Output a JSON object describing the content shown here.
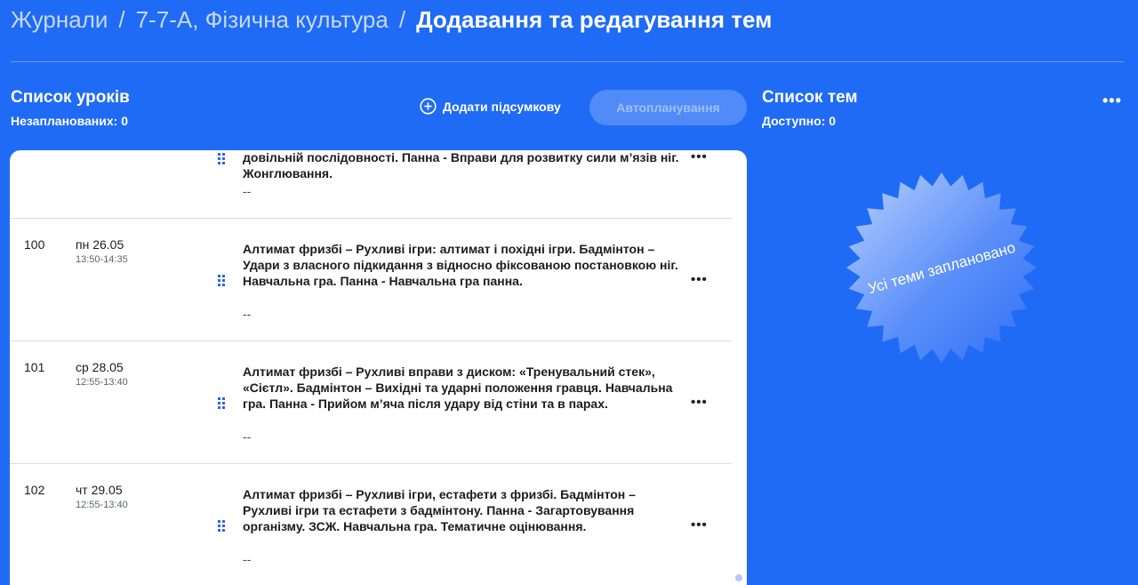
{
  "breadcrumb": {
    "journals": "Журнали",
    "separator": "/",
    "class_subject": "7-7-А, Фізична культура",
    "current": "Додавання та редагування тем"
  },
  "lessons": {
    "title": "Список уроків",
    "unplanned": "Незапланованих: 0",
    "add_summary_label": "Додати підсумкову",
    "add_summary_icon": "plus-circle-icon",
    "autoplan_label": "Автопланування",
    "rows": [
      {
        "number": "",
        "date": "",
        "time": "",
        "topic": "довільній послідовності. Панна - Вправи для розвитку сили м’язів ніг. Жонглювання.",
        "note": "--"
      },
      {
        "number": "100",
        "date": "пн 26.05",
        "time": "13:50-14:35",
        "topic": "Алтимат фризбі – Рухливі ігри: алтимат і похідні ігри. Бадмінтон – Удари з власного підкидання з відносно фіксованою постановкою ніг. Навчальна гра. Панна - Навчальна гра панна.",
        "note": "--"
      },
      {
        "number": "101",
        "date": "ср 28.05",
        "time": "12:55-13:40",
        "topic": "Алтимат фризбі – Рухливі вправи з диском: «Тренувальний стек», «Сієтл». Бадмінтон – Вихідні та ударні положення гравця. Навчальна гра. Панна - Прийом м’яча після удару від стіни та в парах.",
        "note": "--"
      },
      {
        "number": "102",
        "date": "чт 29.05",
        "time": "12:55-13:40",
        "topic": "Алтимат фризбі – Рухливі ігри, естафети з фризбі. Бадмінтон – Рухливі ігри та естафети з бадмінтону. Панна - Загартовування організму. ЗСЖ. Навчальна гра. Тематичне оцінювання.",
        "note": "--"
      }
    ],
    "row_menu": "•••",
    "drag_icon": "drag-handle-icon"
  },
  "topics": {
    "title": "Список тем",
    "available": "Доступно: 0",
    "menu": "•••",
    "badge_text": "Усі теми заплановано"
  },
  "colors": {
    "background": "#1f6bf5",
    "card": "#ffffff",
    "drag_handle": "#2a62e8",
    "badge_gradient_start": "#b9d0ff",
    "badge_gradient_end": "#2e6ff7"
  }
}
